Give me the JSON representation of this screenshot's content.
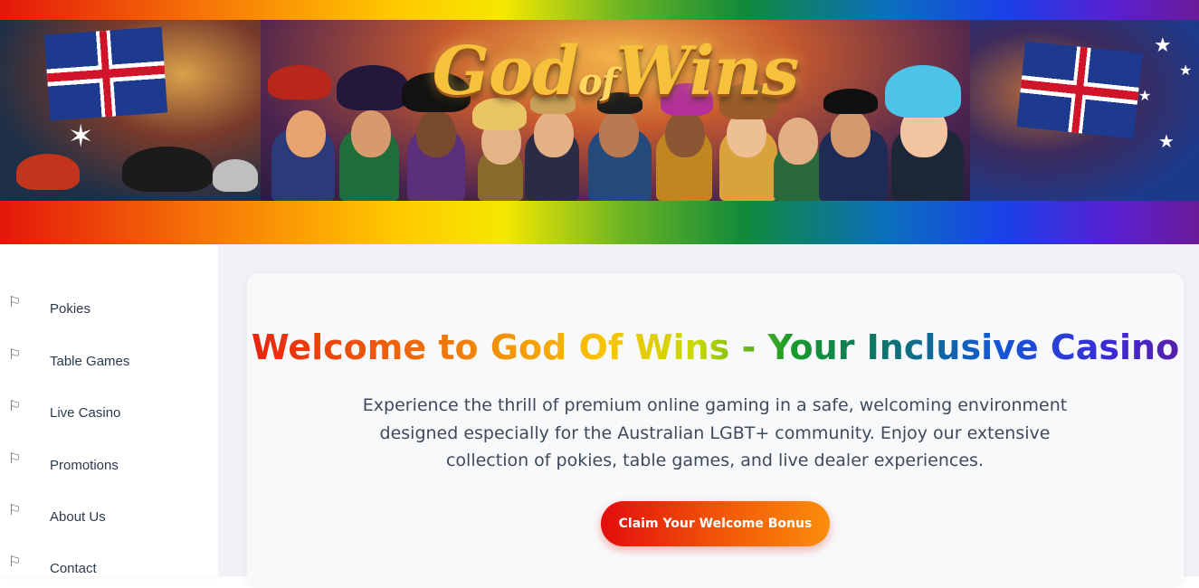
{
  "banner": {
    "logo_main": "God",
    "logo_of": "of",
    "logo_end": "Wins"
  },
  "sidebar": {
    "items": [
      {
        "label": "Pokies",
        "icon": "flag-icon"
      },
      {
        "label": "Table Games",
        "icon": "flag-icon"
      },
      {
        "label": "Live Casino",
        "icon": "flag-icon"
      },
      {
        "label": "Promotions",
        "icon": "flag-icon"
      },
      {
        "label": "About Us",
        "icon": "flag-icon"
      },
      {
        "label": "Contact",
        "icon": "flag-icon"
      }
    ]
  },
  "hero": {
    "title": "Welcome to God Of Wins - Your Inclusive Casino",
    "description": "Experience the thrill of premium online gaming in a safe, welcoming environment designed especially for the Australian LGBT+ community. Enjoy our extensive collection of pokies, table games, and live dealer experiences.",
    "cta_label": "Claim Your Welcome Bonus"
  },
  "colors": {
    "cta_start": "#e20d0d",
    "cta_end": "#fb8e0c",
    "sidebar_text": "#2b3a4d",
    "body_text": "#3e4a5a"
  }
}
